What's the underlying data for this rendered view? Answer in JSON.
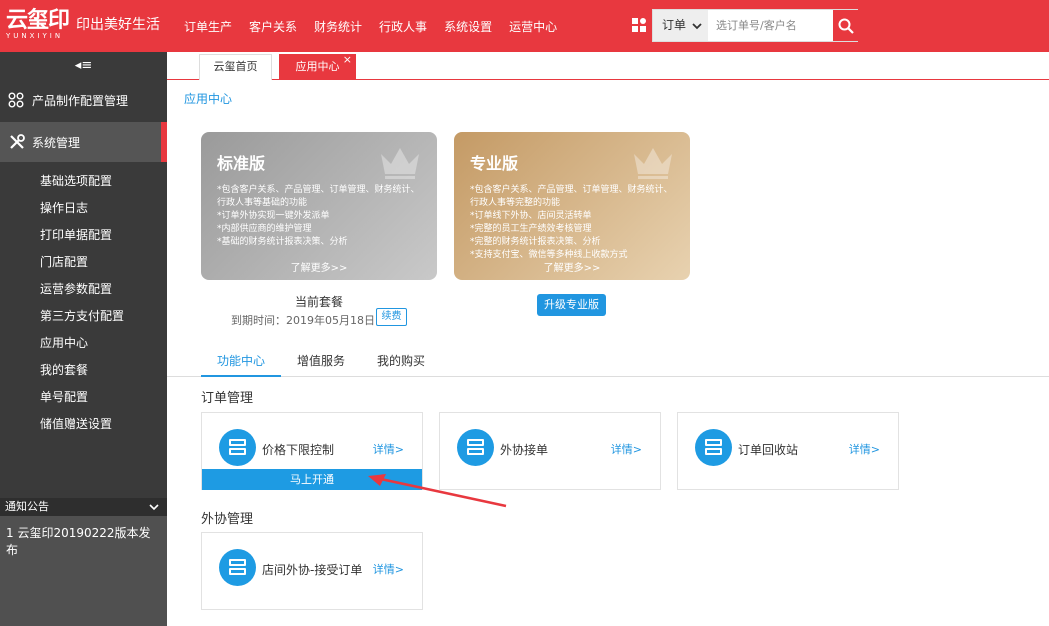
{
  "header": {
    "logo_text": "云玺印",
    "logo_sub": "YUNXIYIN",
    "slogan": "印出美好生活",
    "nav": [
      "订单生产",
      "客户关系",
      "财务统计",
      "行政人事",
      "系统设置",
      "运营中心"
    ],
    "search_type": "订单",
    "search_placeholder": "选订单号/客户名"
  },
  "sidebar": {
    "collapse_icon": "≡",
    "items": [
      {
        "label": "产品制作配置管理",
        "icon": "grid-icon"
      },
      {
        "label": "系统管理",
        "icon": "tools-icon",
        "active": true
      }
    ],
    "submenu": [
      "基础选项配置",
      "操作日志",
      "打印单据配置",
      "门店配置",
      "运营参数配置",
      "第三方支付配置",
      "应用中心",
      "我的套餐",
      "单号配置",
      "储值赠送设置"
    ],
    "notice_title": "通知公告",
    "notice_items": [
      "1 云玺印20190222版本发布"
    ]
  },
  "tabs": [
    {
      "label": "云玺首页"
    },
    {
      "label": "应用中心",
      "active": true
    }
  ],
  "breadcrumb": "应用中心",
  "plans": {
    "standard": {
      "title": "标准版",
      "features": [
        "*包含客户关系、产品管理、订单管理、财务统计、行政人事等基础的功能",
        "*订单外协实现一键外发派单",
        "*内部供应商的维护管理",
        "*基础的财务统计报表决策、分析"
      ],
      "more": "了解更多>>"
    },
    "pro": {
      "title": "专业版",
      "features": [
        "*包含客户关系、产品管理、订单管理、财务统计、行政人事等完整的功能",
        "*订单线下外协、店间灵活转单",
        "*完整的员工生产绩效考核管理",
        "*完整的财务统计报表决策、分析",
        "*支持支付宝、微信等多种线上收款方式"
      ],
      "more": "了解更多>>"
    },
    "current_label": "当前套餐",
    "expire_text": "到期时间：2019年05月18日",
    "renew_label": "续费",
    "upgrade_label": "升级专业版"
  },
  "function_tabs": [
    "功能中心",
    "增值服务",
    "我的购买"
  ],
  "sections": {
    "order": {
      "title": "订单管理",
      "cards": [
        {
          "name": "价格下限控制",
          "detail": "详情>",
          "open": "马上开通"
        },
        {
          "name": "外协接单",
          "detail": "详情>"
        },
        {
          "name": "订单回收站",
          "detail": "详情>"
        }
      ]
    },
    "outsource": {
      "title": "外协管理",
      "cards": [
        {
          "name": "店间外协-接受订单",
          "detail": "详情>"
        }
      ]
    }
  },
  "colors": {
    "brand": "#e8383f",
    "accent": "#1e9be3",
    "sidebar": "#3a3a3a"
  }
}
